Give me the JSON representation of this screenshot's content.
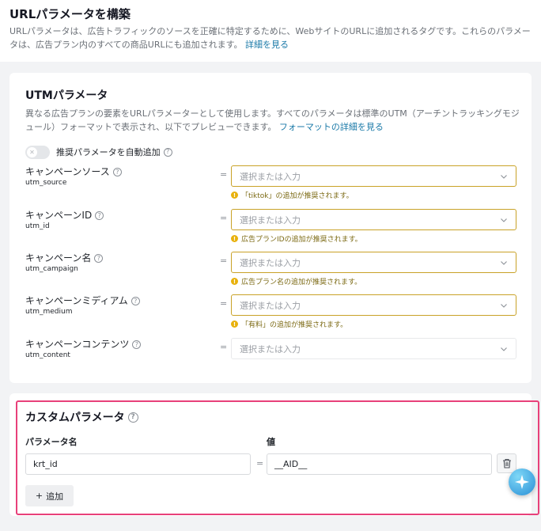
{
  "header": {
    "title": "URLパラメータを構築",
    "description": "URLパラメータは、広告トラフィックのソースを正確に特定するために、Webサイトの​URLに追加されるタグです。これらのパラメータは、広告プラン内のすべての商品URLにも追加されます。",
    "details_link": "詳細を見る"
  },
  "utm": {
    "title": "UTMパラメータ",
    "description": "異なる広告プランの要素をURLパラメーターとして使用します。すべてのパラメータは標準のUTM（アーチントラッキングモジュール）フォーマットで表示され、以下でプレビューできます。",
    "format_link": "フォーマットの詳細を見る",
    "auto_add_label": "推奨パラメータを自動追加",
    "auto_add_enabled": false,
    "equals": "=",
    "placeholder": "選択または入力",
    "params": [
      {
        "label": "キャンペーンソース",
        "key": "utm_source",
        "hint": "「tiktok」の追加が推奨されます。"
      },
      {
        "label": "キャンペーンID",
        "key": "utm_id",
        "hint": "広告プランIDの追加が推奨されます。"
      },
      {
        "label": "キャンペーン名",
        "key": "utm_campaign",
        "hint": "広告プラン名の追加が推奨されます。"
      },
      {
        "label": "キャンペーンミディアム",
        "key": "utm_medium",
        "hint": "「有料」の追加が推奨されます。"
      },
      {
        "label": "キャンペーンコンテンツ",
        "key": "utm_content",
        "hint": ""
      }
    ]
  },
  "custom": {
    "title": "カスタムパラメータ",
    "name_header": "パラメータ名",
    "value_header": "値",
    "rows": [
      {
        "name": "krt_id",
        "value": "__AID__"
      }
    ],
    "equals": "=",
    "add_label": "追加",
    "add_icon": "+"
  },
  "colors": {
    "accent_link": "#1b7aa8",
    "warning": "#e8b10c",
    "highlight": "#e8407a"
  }
}
